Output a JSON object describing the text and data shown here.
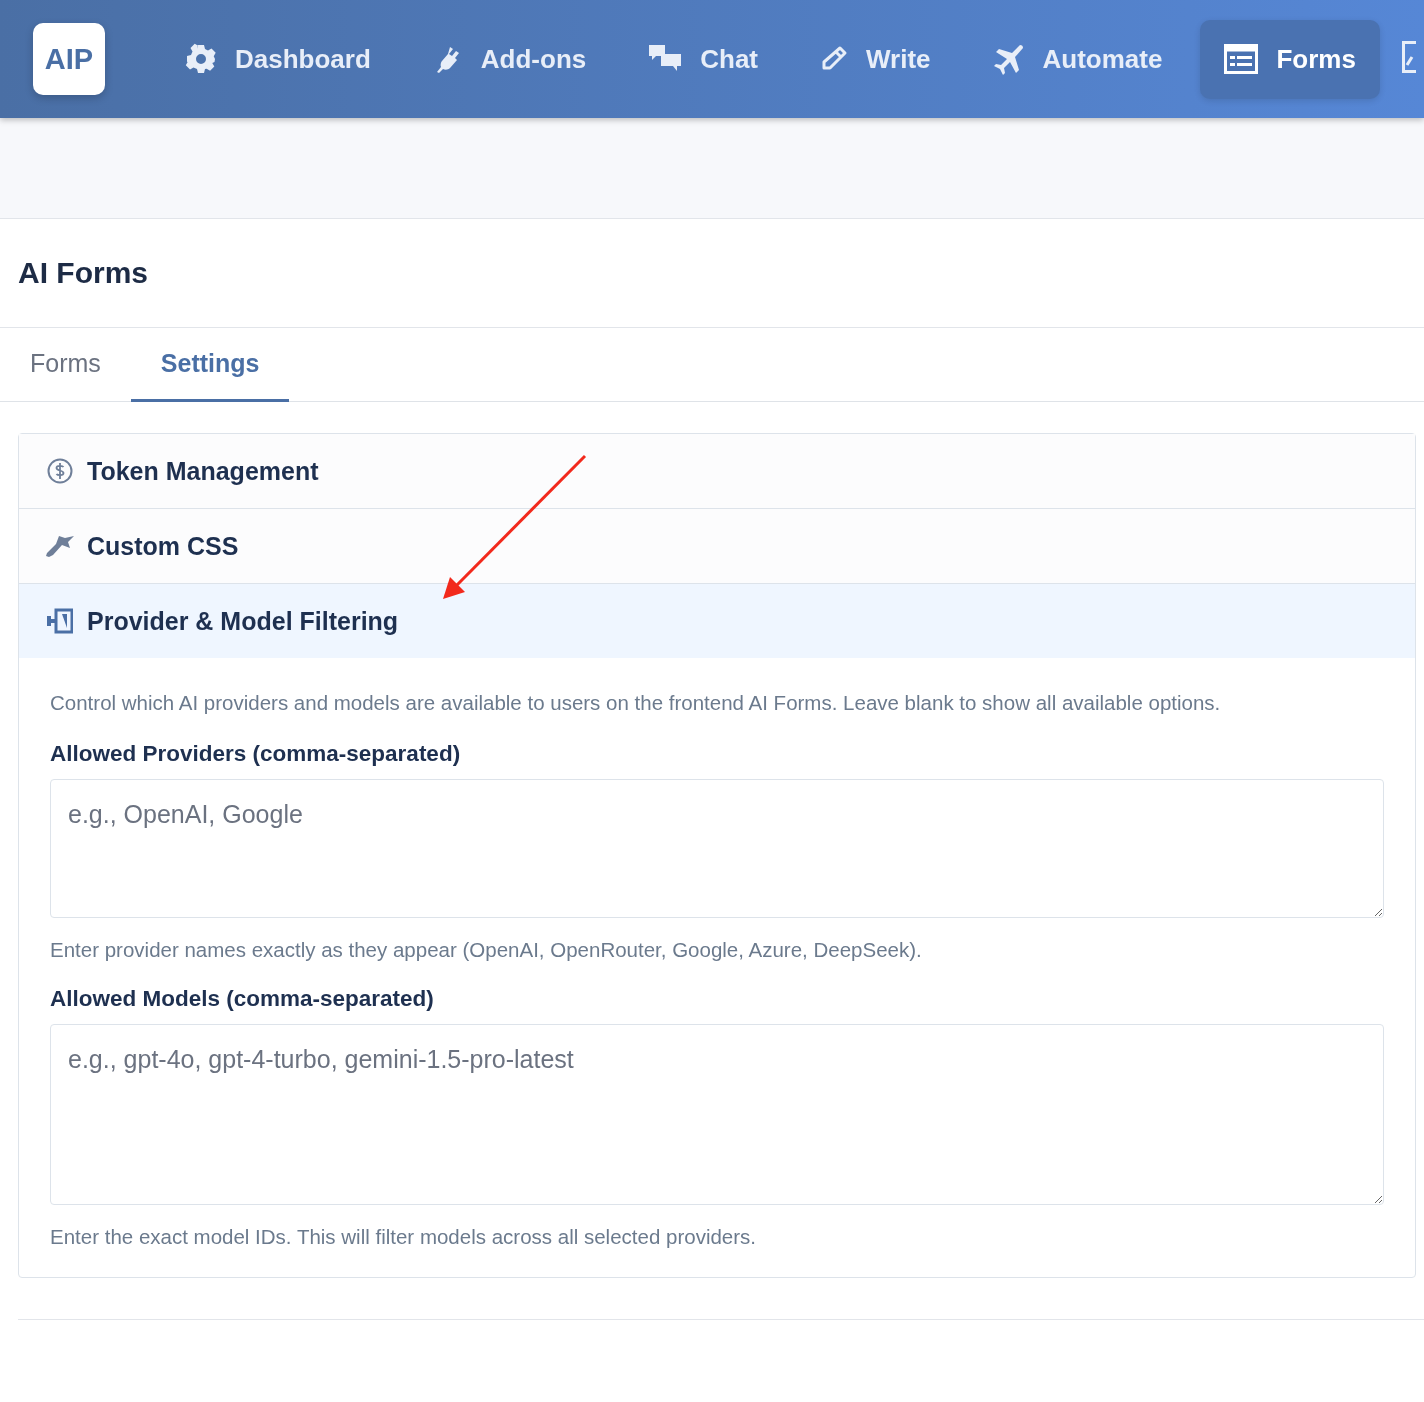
{
  "nav": {
    "logo": "AIP",
    "items": [
      {
        "label": "Dashboard",
        "selected": false
      },
      {
        "label": "Add-ons",
        "selected": false
      },
      {
        "label": "Chat",
        "selected": false
      },
      {
        "label": "Write",
        "selected": false
      },
      {
        "label": "Automate",
        "selected": false
      },
      {
        "label": "Forms",
        "selected": true
      }
    ]
  },
  "page": {
    "title": "AI Forms"
  },
  "tabs": [
    {
      "label": "Forms",
      "selected": false
    },
    {
      "label": "Settings",
      "selected": true
    }
  ],
  "sections": [
    {
      "title": "Token Management",
      "expanded": false
    },
    {
      "title": "Custom CSS",
      "expanded": false
    },
    {
      "title": "Provider & Model Filtering",
      "expanded": true,
      "description": "Control which AI providers and models are available to users on the frontend AI Forms. Leave blank to show all available options.",
      "fields": [
        {
          "label": "Allowed Providers (comma-separated)",
          "placeholder": "e.g., OpenAI, Google",
          "help": "Enter provider names exactly as they appear (OpenAI, OpenRouter, Google, Azure, DeepSeek)."
        },
        {
          "label": "Allowed Models (comma-separated)",
          "placeholder": "e.g., gpt-4o, gpt-4-turbo, gemini-1.5-pro-latest",
          "help": "Enter the exact model IDs. This will filter models across all selected providers."
        }
      ]
    }
  ]
}
